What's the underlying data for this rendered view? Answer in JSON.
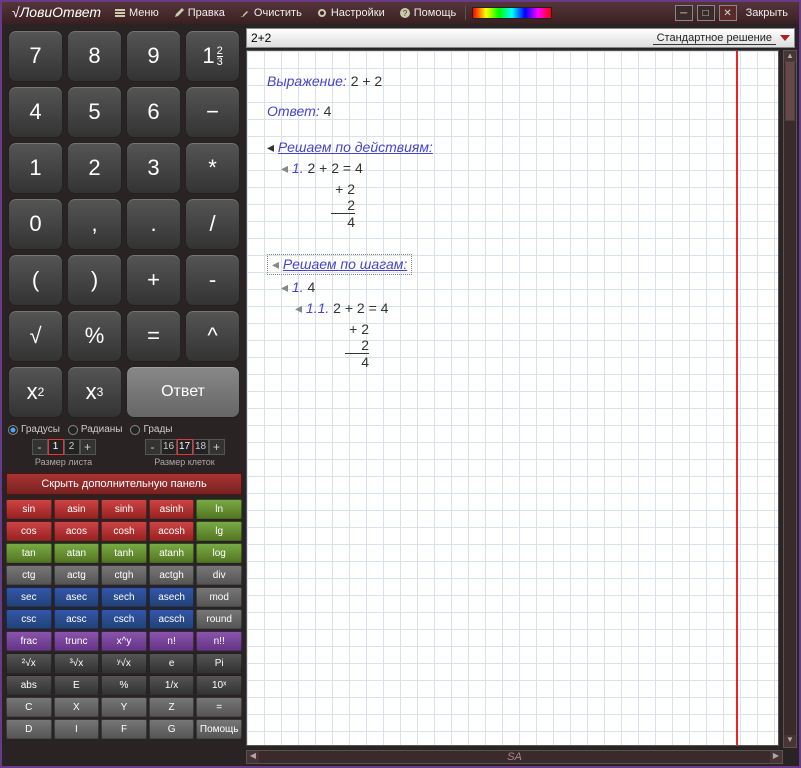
{
  "app": {
    "title": "ЛовиОтвет"
  },
  "menu": {
    "items": [
      "Меню",
      "Правка",
      "Очистить",
      "Настройки",
      "Помощь"
    ],
    "close": "Закрыть"
  },
  "keypad": {
    "rows": [
      [
        "7",
        "8",
        "9",
        "1⅔"
      ],
      [
        "4",
        "5",
        "6",
        "−"
      ],
      [
        "1",
        "2",
        "3",
        "*"
      ],
      [
        "0",
        ",",
        ".",
        "/"
      ],
      [
        "(",
        ")",
        "+",
        "-"
      ],
      [
        "√",
        "%",
        "=",
        "^"
      ]
    ],
    "sq": "x²",
    "cube": "x³",
    "answer": "Ответ"
  },
  "angles": {
    "deg": "Градусы",
    "rad": "Радианы",
    "grad": "Грады",
    "selected": "deg"
  },
  "sizes": {
    "sheet": {
      "label": "Размер листа",
      "vals": [
        "1",
        "2"
      ],
      "sel": 0
    },
    "cell": {
      "label": "Размер клеток",
      "vals": [
        "16",
        "17",
        "18"
      ],
      "sel": 1
    }
  },
  "panel_toggle": "Скрыть дополнительную панель",
  "funcs": [
    {
      "t": "sin",
      "c": "c-red"
    },
    {
      "t": "asin",
      "c": "c-red"
    },
    {
      "t": "sinh",
      "c": "c-red"
    },
    {
      "t": "asinh",
      "c": "c-red"
    },
    {
      "t": "ln",
      "c": "c-grn"
    },
    {
      "t": "cos",
      "c": "c-red"
    },
    {
      "t": "acos",
      "c": "c-red"
    },
    {
      "t": "cosh",
      "c": "c-red"
    },
    {
      "t": "acosh",
      "c": "c-red"
    },
    {
      "t": "lg",
      "c": "c-grn"
    },
    {
      "t": "tan",
      "c": "c-grn"
    },
    {
      "t": "atan",
      "c": "c-grn"
    },
    {
      "t": "tanh",
      "c": "c-grn"
    },
    {
      "t": "atanh",
      "c": "c-grn"
    },
    {
      "t": "log",
      "c": "c-grn"
    },
    {
      "t": "ctg",
      "c": "c-gry"
    },
    {
      "t": "actg",
      "c": "c-gry"
    },
    {
      "t": "ctgh",
      "c": "c-gry"
    },
    {
      "t": "actgh",
      "c": "c-gry"
    },
    {
      "t": "div",
      "c": "c-gry"
    },
    {
      "t": "sec",
      "c": "c-blu"
    },
    {
      "t": "asec",
      "c": "c-blu"
    },
    {
      "t": "sech",
      "c": "c-blu"
    },
    {
      "t": "asech",
      "c": "c-blu"
    },
    {
      "t": "mod",
      "c": "c-gry"
    },
    {
      "t": "csc",
      "c": "c-blu"
    },
    {
      "t": "acsc",
      "c": "c-blu"
    },
    {
      "t": "csch",
      "c": "c-blu"
    },
    {
      "t": "acsch",
      "c": "c-blu"
    },
    {
      "t": "round",
      "c": "c-gry"
    },
    {
      "t": "frac",
      "c": "c-pur"
    },
    {
      "t": "trunc",
      "c": "c-pur"
    },
    {
      "t": "x^y",
      "c": "c-pur"
    },
    {
      "t": "n!",
      "c": "c-pur"
    },
    {
      "t": "n!!",
      "c": "c-pur"
    },
    {
      "t": "²√x",
      "c": "c-drk"
    },
    {
      "t": "³√x",
      "c": "c-drk"
    },
    {
      "t": "ʸ√x",
      "c": "c-drk"
    },
    {
      "t": "e",
      "c": "c-drk"
    },
    {
      "t": "Pi",
      "c": "c-drk"
    },
    {
      "t": "abs",
      "c": "c-drk"
    },
    {
      "t": "E",
      "c": "c-drk"
    },
    {
      "t": "%",
      "c": "c-drk"
    },
    {
      "t": "1/x",
      "c": "c-drk"
    },
    {
      "t": "10ˣ",
      "c": "c-drk"
    },
    {
      "t": "C",
      "c": "c-gry"
    },
    {
      "t": "X",
      "c": "c-gry"
    },
    {
      "t": "Y",
      "c": "c-gry"
    },
    {
      "t": "Z",
      "c": "c-gry"
    },
    {
      "t": "=",
      "c": "c-gry"
    },
    {
      "t": "D",
      "c": "c-gry"
    },
    {
      "t": "I",
      "c": "c-gry"
    },
    {
      "t": "F",
      "c": "c-gry"
    },
    {
      "t": "G",
      "c": "c-gry"
    },
    {
      "t": "Помощь",
      "c": "c-gry"
    }
  ],
  "formula": {
    "input": "2+2",
    "mode": "Стандартное решение"
  },
  "solution": {
    "expr_label": "Выражение:",
    "expr": "2 + 2",
    "ans_label": "Ответ:",
    "ans": "4",
    "by_actions": "Решаем по действиям:",
    "step1_num": "1.",
    "step1": "2 + 2 = 4",
    "col": {
      "op": "+",
      "a": "2",
      "b": "2",
      "r": "4"
    },
    "by_steps": "Решаем по шагам:",
    "s1_num": "1.",
    "s1": "4",
    "s11_num": "1.1.",
    "s11": "2 + 2 = 4"
  },
  "footer": {
    "brand": "SA"
  }
}
